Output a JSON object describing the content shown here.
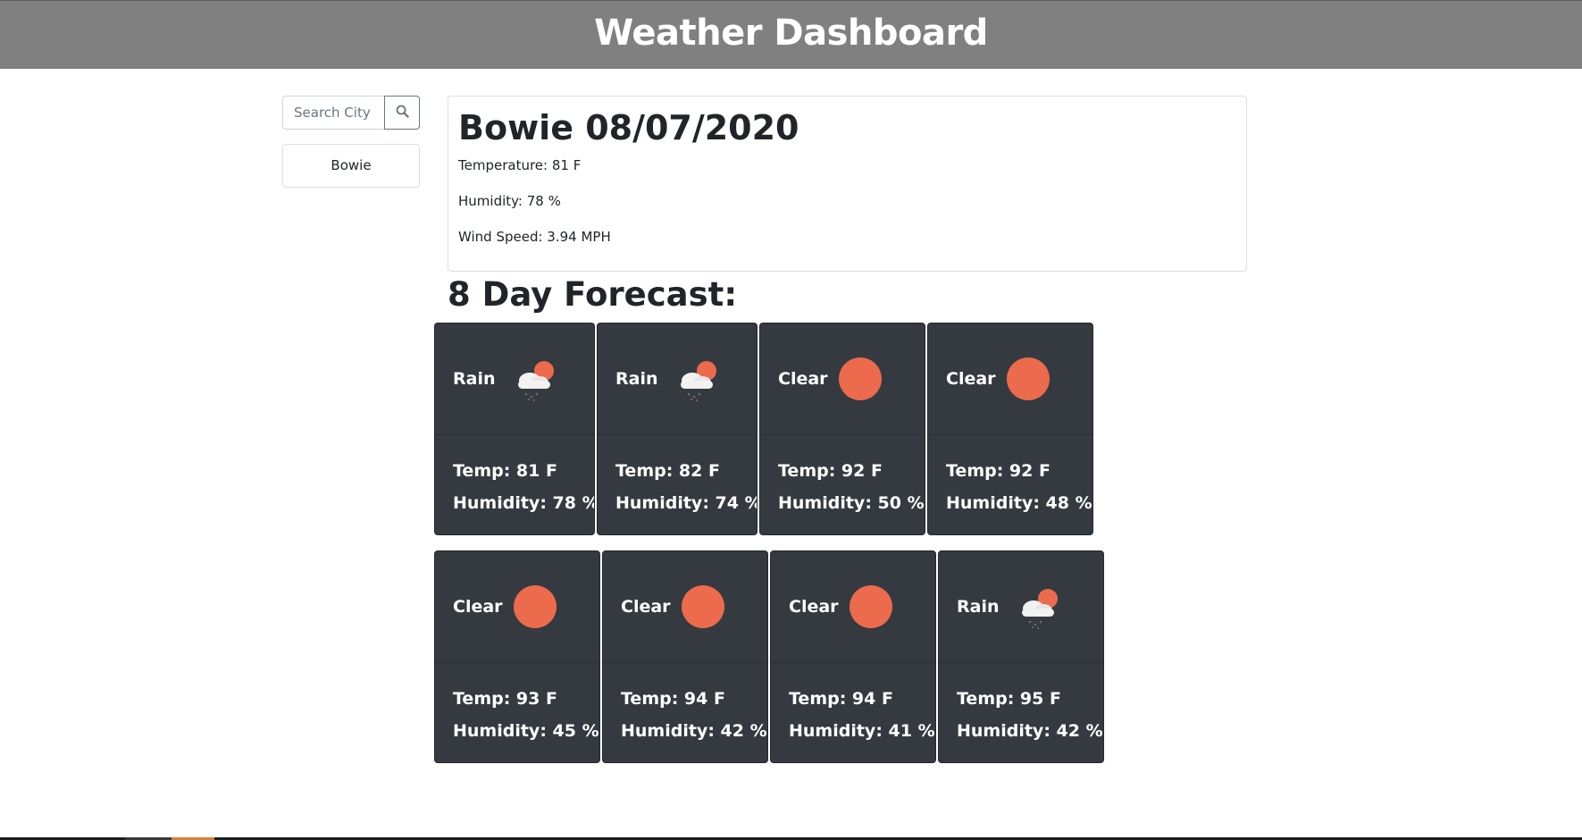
{
  "header": {
    "title": "Weather Dashboard"
  },
  "sidebar": {
    "search": {
      "placeholder": "Search City",
      "value": ""
    },
    "history": [
      {
        "label": "Bowie"
      }
    ]
  },
  "current": {
    "title": "Bowie 08/07/2020",
    "temperature": "Temperature: 81 F",
    "humidity": "Humidity: 78 %",
    "wind": "Wind Speed: 3.94 MPH"
  },
  "forecast": {
    "heading": "8 Day Forecast:",
    "days": [
      {
        "condition": "Rain",
        "icon": "rain-cloud-sun-icon",
        "temp": "Temp: 81 F",
        "humidity": "Humidity: 78 %"
      },
      {
        "condition": "Rain",
        "icon": "rain-cloud-sun-icon",
        "temp": "Temp: 82 F",
        "humidity": "Humidity: 74 %"
      },
      {
        "condition": "Clear",
        "icon": "sun-icon",
        "temp": "Temp: 92 F",
        "humidity": "Humidity: 50 %"
      },
      {
        "condition": "Clear",
        "icon": "sun-icon",
        "temp": "Temp: 92 F",
        "humidity": "Humidity: 48 %"
      },
      {
        "condition": "Clear",
        "icon": "sun-icon",
        "temp": "Temp: 93 F",
        "humidity": "Humidity: 45 %"
      },
      {
        "condition": "Clear",
        "icon": "sun-icon",
        "temp": "Temp: 94 F",
        "humidity": "Humidity: 42 %"
      },
      {
        "condition": "Clear",
        "icon": "sun-icon",
        "temp": "Temp: 94 F",
        "humidity": "Humidity: 41 %"
      },
      {
        "condition": "Rain",
        "icon": "rain-cloud-sun-icon",
        "temp": "Temp: 95 F",
        "humidity": "Humidity: 42 %"
      }
    ]
  },
  "colors": {
    "header_bg": "#808080",
    "card_bg": "#343a40",
    "sun": "#ec6b4c"
  }
}
